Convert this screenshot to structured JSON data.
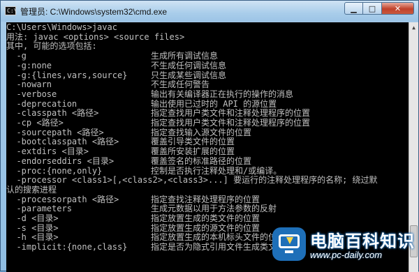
{
  "window": {
    "title": "管理员: C:\\Windows\\system32\\cmd.exe",
    "icon_text": "C:\\",
    "controls": {
      "minimize": "▁",
      "maximize": "□",
      "close": "✕"
    }
  },
  "console": {
    "lines": [
      {
        "a": "C:\\Users\\Windows>javac",
        "b": ""
      },
      {
        "a": "用法: javac <options> <source files>",
        "b": ""
      },
      {
        "a": "其中, 可能的选项包括:",
        "b": ""
      },
      {
        "a": "  -g",
        "b": "生成所有调试信息"
      },
      {
        "a": "  -g:none",
        "b": "不生成任何调试信息"
      },
      {
        "a": "  -g:{lines,vars,source}",
        "b": "只生成某些调试信息"
      },
      {
        "a": "  -nowarn",
        "b": "不生成任何警告"
      },
      {
        "a": "  -verbose",
        "b": "输出有关编译器正在执行的操作的消息"
      },
      {
        "a": "  -deprecation",
        "b": "输出使用已过时的 API 的源位置"
      },
      {
        "a": "  -classpath <路径>",
        "b": "指定查找用户类文件和注释处理程序的位置"
      },
      {
        "a": "  -cp <路径>",
        "b": "指定查找用户类文件和注释处理程序的位置"
      },
      {
        "a": "  -sourcepath <路径>",
        "b": "指定查找输入源文件的位置"
      },
      {
        "a": "  -bootclasspath <路径>",
        "b": "覆盖引导类文件的位置"
      },
      {
        "a": "  -extdirs <目录>",
        "b": "覆盖所安装扩展的位置"
      },
      {
        "a": "  -endorseddirs <目录>",
        "b": "覆盖签名的标准路径的位置"
      },
      {
        "a": "  -proc:{none,only}",
        "b": "控制是否执行注释处理和/或编译。"
      },
      {
        "a": "  -processor <class1>[,<class2>,<class3>...] 要运行的注释处理程序的名称; 绕过默",
        "b": ""
      },
      {
        "a": "认的搜索进程",
        "b": ""
      },
      {
        "a": "  -processorpath <路径>",
        "b": "指定查找注释处理程序的位置"
      },
      {
        "a": "  -parameters",
        "b": "生成元数据以用于方法参数的反射"
      },
      {
        "a": "  -d <目录>",
        "b": "指定放置生成的类文件的位置"
      },
      {
        "a": "  -s <目录>",
        "b": "指定放置生成的源文件的位置"
      },
      {
        "a": "  -h <目录>",
        "b": "指定放置生成的本机标头文件的位置"
      },
      {
        "a": "  -implicit:{none,class}",
        "b": "指定是否为隐式引用文件生成类文件"
      }
    ]
  },
  "watermark": {
    "title": "电脑百科知识",
    "url": "www.pc-daily.com"
  }
}
